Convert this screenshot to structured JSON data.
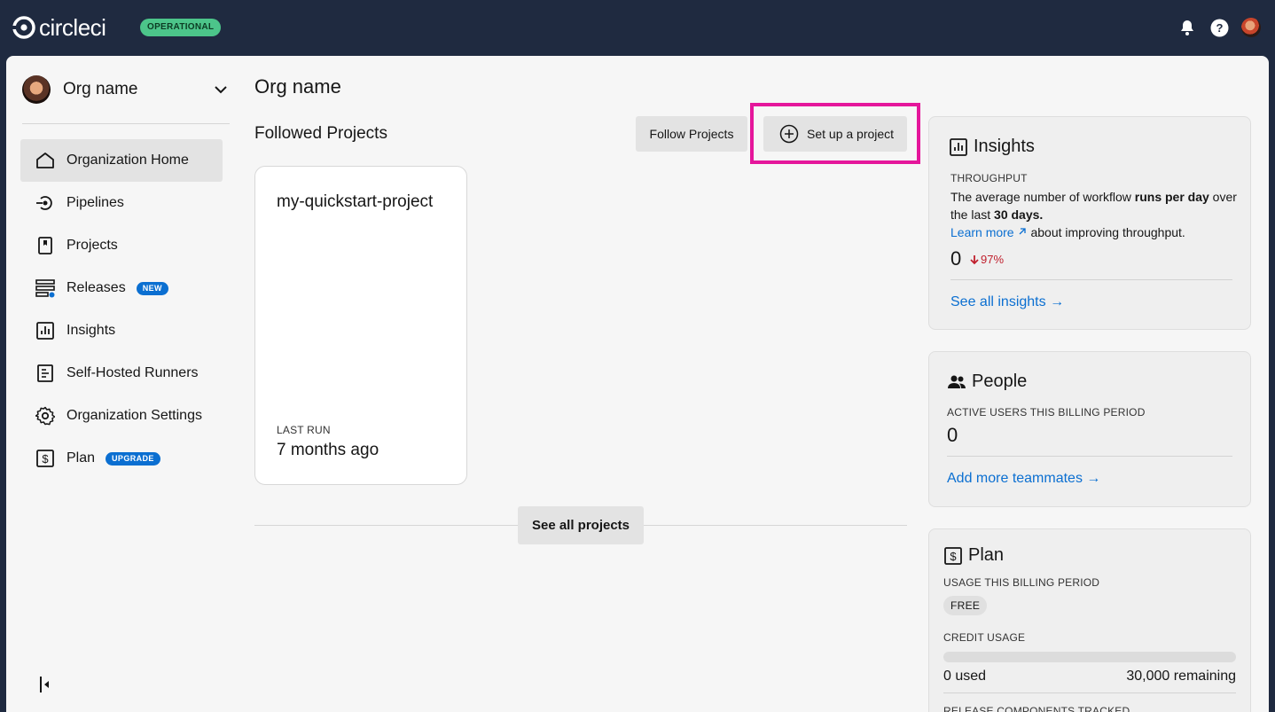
{
  "topbar": {
    "logo_text": "circleci",
    "status": "OPERATIONAL"
  },
  "sidebar": {
    "org_name": "Org name",
    "items": [
      {
        "label": "Organization Home",
        "icon": "home-icon",
        "active": true
      },
      {
        "label": "Pipelines",
        "icon": "pipelines-icon"
      },
      {
        "label": "Projects",
        "icon": "projects-icon"
      },
      {
        "label": "Releases",
        "icon": "releases-icon",
        "badge": "NEW"
      },
      {
        "label": "Insights",
        "icon": "insights-icon"
      },
      {
        "label": "Self-Hosted Runners",
        "icon": "runners-icon"
      },
      {
        "label": "Organization Settings",
        "icon": "gear-icon"
      },
      {
        "label": "Plan",
        "icon": "plan-icon",
        "badge": "UPGRADE"
      }
    ]
  },
  "main": {
    "title": "Org name",
    "section_title": "Followed Projects",
    "follow_projects_label": "Follow Projects",
    "setup_project_label": "Set up a project",
    "project_card": {
      "name": "my-quickstart-project",
      "last_run_label": "LAST RUN",
      "last_run_value": "7 months ago"
    },
    "see_all_projects_label": "See all projects"
  },
  "insights": {
    "title": "Insights",
    "caption": "THROUGHPUT",
    "text_1": "The average number of workflow ",
    "text_bold_1": "runs per day",
    "text_2": " over the last ",
    "text_bold_2": "30 days.",
    "learn_more": "Learn more",
    "learn_more_suffix": " about improving throughput.",
    "value": "0",
    "delta": "97%",
    "see_all": "See all insights →"
  },
  "people": {
    "title": "People",
    "caption": "ACTIVE USERS THIS BILLING PERIOD",
    "value": "0",
    "add_link": "Add more teammates →"
  },
  "plan": {
    "title": "Plan",
    "caption": "USAGE THIS BILLING PERIOD",
    "plan_pill": "FREE",
    "credit_caption": "CREDIT USAGE",
    "credit_used_fraction": 0,
    "used": "0 used",
    "remaining": "30,000 remaining",
    "release_caption": "RELEASE COMPONENTS TRACKED"
  },
  "colors": {
    "topbar": "#1f2a40",
    "operational": "#4cc58a",
    "accent": "#0b6fd1",
    "highlight": "#e5169b",
    "negative": "#c01f2d"
  }
}
